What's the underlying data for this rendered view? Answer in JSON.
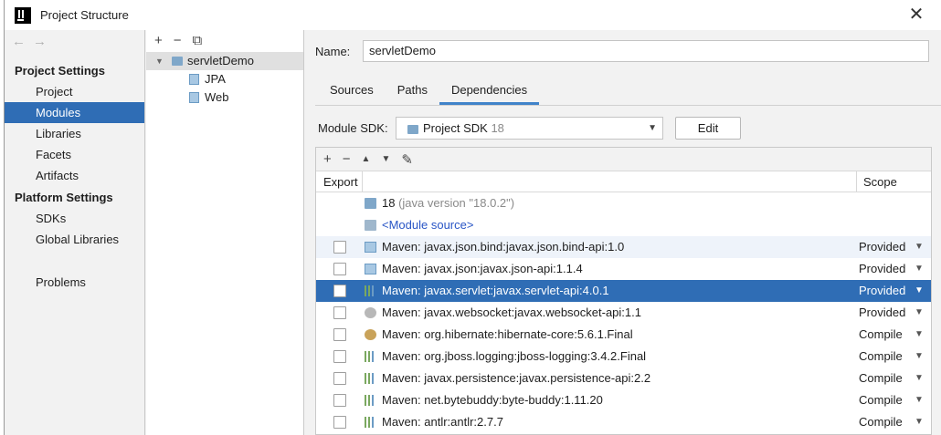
{
  "window": {
    "title": "Project Structure"
  },
  "nav": {
    "project_settings_heading": "Project Settings",
    "platform_settings_heading": "Platform Settings",
    "items": [
      {
        "label": "Project"
      },
      {
        "label": "Modules"
      },
      {
        "label": "Libraries"
      },
      {
        "label": "Facets"
      },
      {
        "label": "Artifacts"
      },
      {
        "label": "SDKs"
      },
      {
        "label": "Global Libraries"
      },
      {
        "label": "Problems"
      }
    ],
    "selected": "Modules"
  },
  "tree": {
    "module": "servletDemo",
    "children": [
      {
        "label": "JPA"
      },
      {
        "label": "Web"
      }
    ]
  },
  "main": {
    "name_label": "Name:",
    "name_value": "servletDemo",
    "tabs": [
      {
        "label": "Sources"
      },
      {
        "label": "Paths"
      },
      {
        "label": "Dependencies"
      }
    ],
    "active_tab": "Dependencies",
    "sdk_label": "Module SDK:",
    "sdk_value": "Project SDK",
    "sdk_version": "18",
    "edit_label": "Edit"
  },
  "deps": {
    "header_export": "Export",
    "header_scope": "Scope",
    "sdk_row": {
      "name": "18",
      "detail": "(java version \"18.0.2\")"
    },
    "source_row": "<Module source>",
    "rows": [
      {
        "name": "Maven: javax.json.bind:javax.json.bind-api:1.0",
        "scope": "Provided"
      },
      {
        "name": "Maven: javax.json:javax.json-api:1.1.4",
        "scope": "Provided"
      },
      {
        "name": "Maven: javax.servlet:javax.servlet-api:4.0.1",
        "scope": "Provided"
      },
      {
        "name": "Maven: javax.websocket:javax.websocket-api:1.1",
        "scope": "Provided"
      },
      {
        "name": "Maven: org.hibernate:hibernate-core:5.6.1.Final",
        "scope": "Compile"
      },
      {
        "name": "Maven: org.jboss.logging:jboss-logging:3.4.2.Final",
        "scope": "Compile"
      },
      {
        "name": "Maven: javax.persistence:javax.persistence-api:2.2",
        "scope": "Compile"
      },
      {
        "name": "Maven: net.bytebuddy:byte-buddy:1.11.20",
        "scope": "Compile"
      },
      {
        "name": "Maven: antlr:antlr:2.7.7",
        "scope": "Compile"
      }
    ],
    "selected_row": "Maven: javax.servlet:javax.servlet-api:4.0.1"
  },
  "colors": {
    "selection": "#2f6db5",
    "tab_underline": "#4083c9",
    "link": "#2a56c6"
  }
}
